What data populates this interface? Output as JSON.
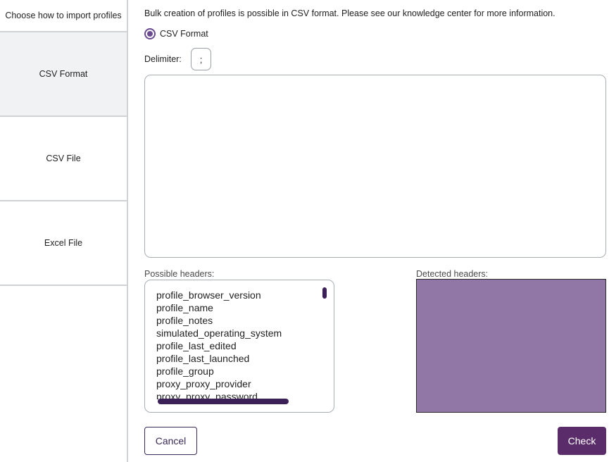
{
  "sidebar": {
    "title": "Choose how to import profiles",
    "items": [
      {
        "label": "CSV Format"
      },
      {
        "label": "CSV File"
      },
      {
        "label": "Excel File"
      }
    ]
  },
  "main": {
    "info_text": "Bulk creation of profiles is possible in CSV format. Please see our knowledge center for more information.",
    "radio_label": "CSV Format",
    "delimiter_label": "Delimiter:",
    "delimiter_value": ";",
    "csv_text": "",
    "possible_headers_label": "Possible headers:",
    "detected_headers_label": "Detected headers:",
    "possible_headers": [
      "profile_browser_version",
      "profile_name",
      "profile_notes",
      "simulated_operating_system",
      "profile_last_edited",
      "profile_last_launched",
      "profile_group",
      "proxy_proxy_provider",
      "proxy_proxy_password"
    ],
    "cancel_label": "Cancel",
    "check_label": "Check"
  },
  "colors": {
    "accent": "#5a2d6a",
    "radio": "#6b4a8f",
    "detected_fill": "#9177a6",
    "scrollbar": "#3b2157",
    "active_tab_bg": "#f0f2f3"
  }
}
